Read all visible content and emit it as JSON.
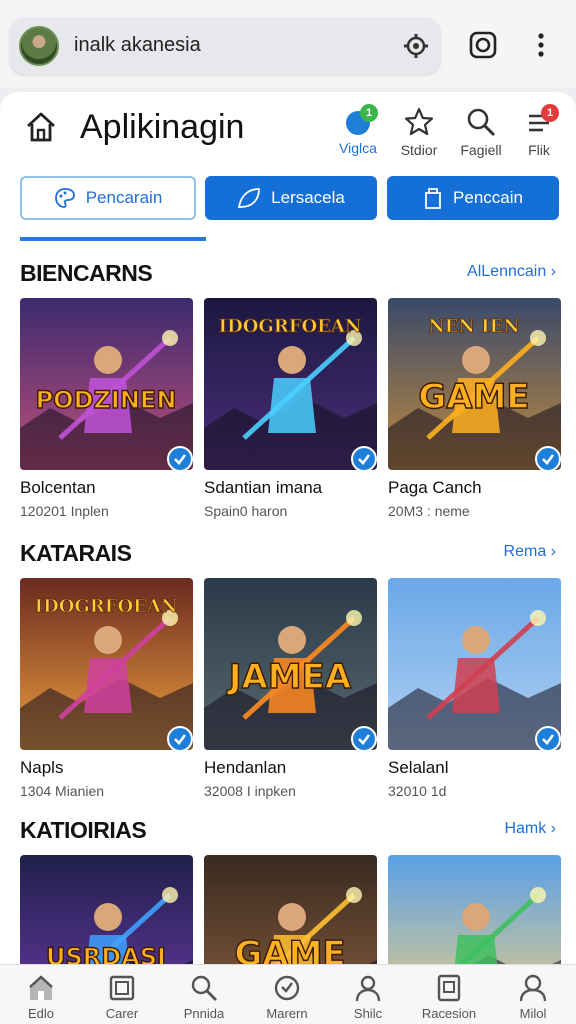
{
  "browser": {
    "address_text": "inalk akanesia",
    "address_icon": "settings-gear-icon",
    "camera_icon": "camera-icon",
    "menu_icon": "more-vertical-icon"
  },
  "header": {
    "title": "Aplikinagin",
    "actions": [
      {
        "label": "Viglca",
        "icon": "notification-dot-icon",
        "badge": "1",
        "badge_color": "#3bb54a",
        "accent": "#1f6fd8"
      },
      {
        "label": "Stdior",
        "icon": "star-icon"
      },
      {
        "label": "Fagiell",
        "icon": "search-icon"
      },
      {
        "label": "Flik",
        "icon": "menu-lines-icon",
        "badge": "1",
        "badge_color": "#e23b3b"
      }
    ]
  },
  "filters": [
    {
      "label": "Pencarain",
      "icon": "palette-icon",
      "style": "outline"
    },
    {
      "label": "Lersacela",
      "icon": "leaf-icon",
      "style": "filled"
    },
    {
      "label": "Penccain",
      "icon": "bag-icon",
      "style": "filled"
    }
  ],
  "sections": [
    {
      "title": "BIENCARNS",
      "link": "AlLenncain",
      "cards": [
        {
          "title": "Bolcentan",
          "sub": "120201 Inplen",
          "art_text": "PODZINEN",
          "art_top": "",
          "sky1": "#3b2a6e",
          "sky2": "#c0507a",
          "accent": "#c052d9"
        },
        {
          "title": "Sdantian imana",
          "sub": "Spain0 haron",
          "art_text": "",
          "art_top": "IDOGRFOEAN",
          "sky1": "#1c1840",
          "sky2": "#4a2f7a",
          "accent": "#4ad0ff"
        },
        {
          "title": "Paga Canch",
          "sub": "20M3 : neme",
          "art_text": "GAME",
          "art_top": "NEN IEN",
          "sky1": "#3a4a6a",
          "sky2": "#c08a40",
          "accent": "#ffb020"
        }
      ]
    },
    {
      "title": "KATARAIS",
      "link": "Rema",
      "cards": [
        {
          "title": "Napls",
          "sub": "1304 Mianien",
          "art_text": "",
          "art_top": "IDOGRFOEAN",
          "sky1": "#6a2a20",
          "sky2": "#f0a040",
          "accent": "#d040a0"
        },
        {
          "title": "Hendanlan",
          "sub": "32008 I inpken",
          "art_text": "JAMEA",
          "art_top": "",
          "sky1": "#2a3a48",
          "sky2": "#5a6a70",
          "accent": "#ff8a20"
        },
        {
          "title": "Selalanl",
          "sub": "32010 1d",
          "art_text": "",
          "art_top": "",
          "sky1": "#6aa8e8",
          "sky2": "#b0d0f0",
          "accent": "#d04050"
        }
      ]
    },
    {
      "title": "KATIOIRIAS",
      "link": "Hamk",
      "cards": [
        {
          "title": "",
          "sub": "",
          "art_text": "USRDASI",
          "art_top": "",
          "sky1": "#20204a",
          "sky2": "#6a3aa8",
          "accent": "#40a0ff"
        },
        {
          "title": "",
          "sub": "",
          "art_text": "GAME",
          "art_top": "",
          "sky1": "#3a2a20",
          "sky2": "#8a6040",
          "accent": "#ffc030"
        },
        {
          "title": "",
          "sub": "",
          "art_text": "",
          "art_top": "",
          "sky1": "#5aa0e8",
          "sky2": "#f0d080",
          "accent": "#40c060"
        }
      ]
    }
  ],
  "bottom_nav": [
    {
      "label": "Edlo",
      "icon": "home-icon"
    },
    {
      "label": "Carer",
      "icon": "frame-icon"
    },
    {
      "label": "Pnnida",
      "icon": "search-icon"
    },
    {
      "label": "Marern",
      "icon": "clock-icon"
    },
    {
      "label": "Shilc",
      "icon": "person-icon"
    },
    {
      "label": "Racesion",
      "icon": "tablet-icon"
    },
    {
      "label": "Milol",
      "icon": "profile-icon"
    }
  ]
}
